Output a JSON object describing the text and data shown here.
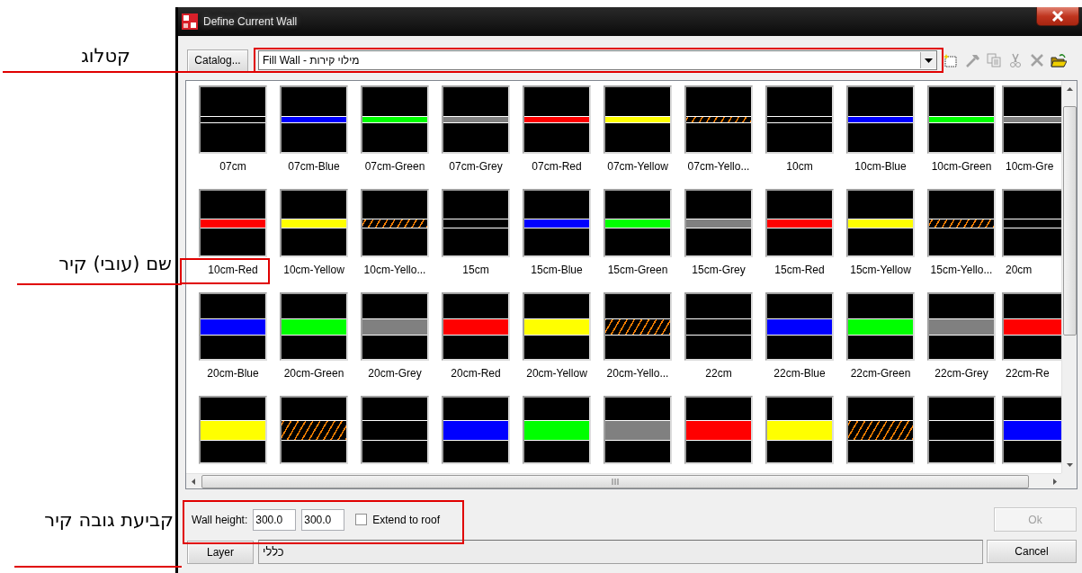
{
  "annotations": [
    {
      "text": "קטלוג"
    },
    {
      "text": "שם (עובי) קיר"
    },
    {
      "text": "קביעת גובה קיר"
    }
  ],
  "window": {
    "title": "Define Current Wall"
  },
  "catalog_button": "Catalog...",
  "catalog_combo": {
    "value": "Fill Wall - מילוי קירות"
  },
  "toolbar": [
    {
      "kind": "new",
      "disabled": false
    },
    {
      "kind": "hammer",
      "disabled": true
    },
    {
      "kind": "copy",
      "disabled": true
    },
    {
      "kind": "cut",
      "disabled": true
    },
    {
      "kind": "delete",
      "disabled": true
    },
    {
      "kind": "open",
      "disabled": false
    }
  ],
  "rows": [
    {
      "swatches": [
        {
          "label": "07cm",
          "kind": "line"
        },
        {
          "label": "07cm-Blue",
          "kind": "band",
          "color": "#0000ff"
        },
        {
          "label": "07cm-Green",
          "kind": "band",
          "color": "#00ff00"
        },
        {
          "label": "07cm-Grey",
          "kind": "band",
          "color": "#808080"
        },
        {
          "label": "07cm-Red",
          "kind": "band",
          "color": "#ff0000"
        },
        {
          "label": "07cm-Yellow",
          "kind": "band",
          "color": "#ffff00"
        },
        {
          "label": "07cm-Yello...",
          "kind": "hatch",
          "color": "#ff8000"
        },
        {
          "label": "10cm",
          "kind": "line"
        },
        {
          "label": "10cm-Blue",
          "kind": "band",
          "color": "#0000ff"
        },
        {
          "label": "10cm-Green",
          "kind": "band",
          "color": "#00ff00"
        },
        {
          "label": "10cm-Gre",
          "kind": "band",
          "color": "#808080"
        }
      ]
    },
    {
      "swatches": [
        {
          "label": "10cm-Red",
          "kind": "band",
          "color": "#ff0000"
        },
        {
          "label": "10cm-Yellow",
          "kind": "band",
          "color": "#ffff00"
        },
        {
          "label": "10cm-Yello...",
          "kind": "hatch",
          "color": "#ff8000"
        },
        {
          "label": "15cm",
          "kind": "line"
        },
        {
          "label": "15cm-Blue",
          "kind": "band",
          "color": "#0000ff"
        },
        {
          "label": "15cm-Green",
          "kind": "band",
          "color": "#00ff00"
        },
        {
          "label": "15cm-Grey",
          "kind": "band",
          "color": "#808080"
        },
        {
          "label": "15cm-Red",
          "kind": "band",
          "color": "#ff0000"
        },
        {
          "label": "15cm-Yellow",
          "kind": "band",
          "color": "#ffff00"
        },
        {
          "label": "15cm-Yello...",
          "kind": "hatch",
          "color": "#ff8000"
        },
        {
          "label": "20cm",
          "kind": "line"
        }
      ]
    },
    {
      "swatches": [
        {
          "label": "20cm-Blue",
          "kind": "band",
          "color": "#0000ff"
        },
        {
          "label": "20cm-Green",
          "kind": "band",
          "color": "#00ff00"
        },
        {
          "label": "20cm-Grey",
          "kind": "band",
          "color": "#808080"
        },
        {
          "label": "20cm-Red",
          "kind": "band",
          "color": "#ff0000"
        },
        {
          "label": "20cm-Yellow",
          "kind": "band",
          "color": "#ffff00"
        },
        {
          "label": "20cm-Yello...",
          "kind": "hatch",
          "color": "#ff8000"
        },
        {
          "label": "22cm",
          "kind": "line"
        },
        {
          "label": "22cm-Blue",
          "kind": "band",
          "color": "#0000ff"
        },
        {
          "label": "22cm-Green",
          "kind": "band",
          "color": "#00ff00"
        },
        {
          "label": "22cm-Grey",
          "kind": "band",
          "color": "#808080"
        },
        {
          "label": "22cm-Re",
          "kind": "band",
          "color": "#ff0000"
        }
      ]
    },
    {
      "swatches": [
        {
          "kind": "band",
          "color": "#ffff00"
        },
        {
          "kind": "hatch",
          "color": "#ff8000"
        },
        {
          "kind": "line"
        },
        {
          "kind": "band",
          "color": "#0000ff"
        },
        {
          "kind": "band",
          "color": "#00ff00"
        },
        {
          "kind": "band",
          "color": "#808080"
        },
        {
          "kind": "band",
          "color": "#ff0000"
        },
        {
          "kind": "band",
          "color": "#ffff00"
        },
        {
          "kind": "hatch",
          "color": "#ff8000"
        },
        {
          "kind": "line"
        },
        {
          "kind": "band",
          "color": "#0000ff"
        }
      ]
    }
  ],
  "wall_height": {
    "label": "Wall height:",
    "values": [
      "300.0",
      "300.0"
    ]
  },
  "extend_to_roof": {
    "label": "Extend to roof",
    "checked": false
  },
  "ok_button": {
    "label": "Ok",
    "disabled": true
  },
  "layer_button": "Layer",
  "layer_field": {
    "value": "כללי"
  },
  "cancel_button": "Cancel"
}
